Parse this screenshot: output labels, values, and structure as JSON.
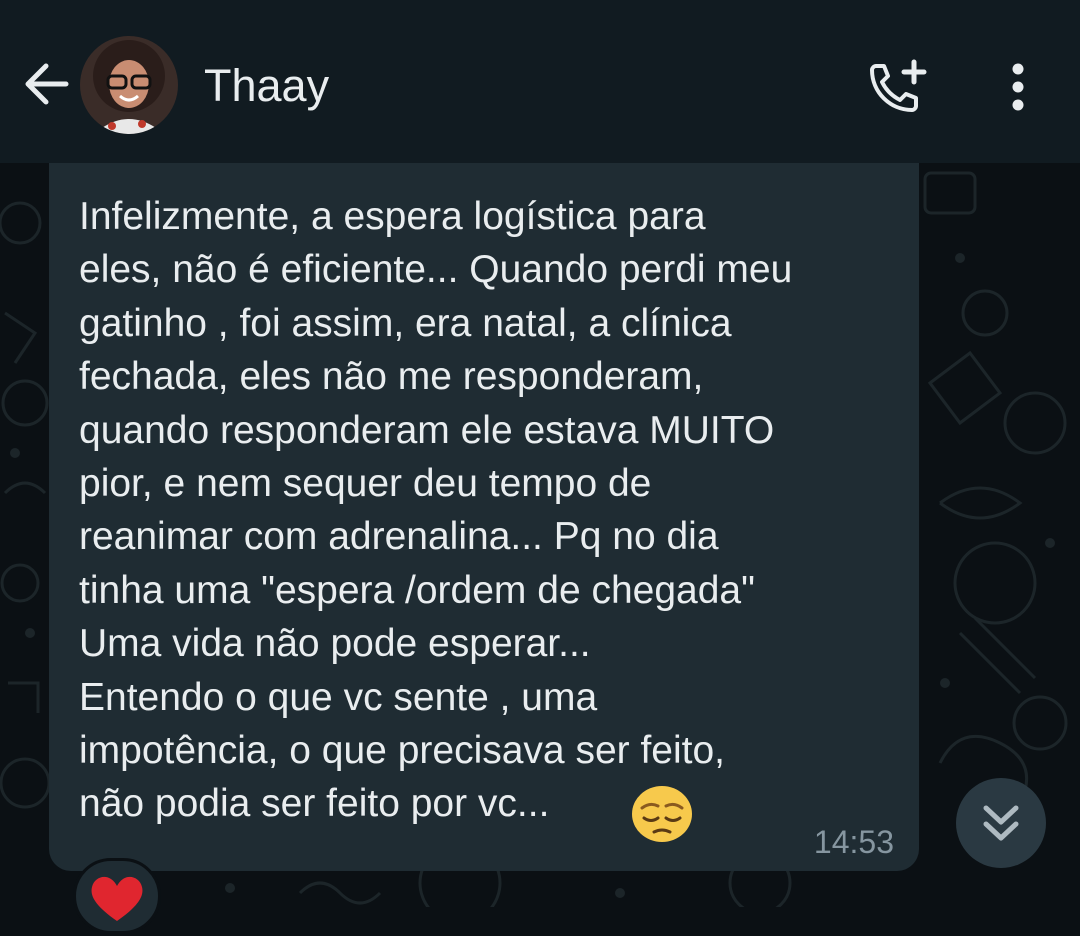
{
  "header": {
    "contact_name": "Thaay",
    "back_icon": "arrow-left-icon",
    "call_icon": "add-call-icon",
    "menu_icon": "more-vertical-icon"
  },
  "message": {
    "text": "Infelizmente, a espera logística para\neles, não é eficiente... Quando perdi meu\ngatinho , foi assim, era natal, a clínica\nfechada, eles não me responderam,\nquando responderam ele estava MUITO\npior, e nem sequer deu tempo de\nreanimar com adrenalina... Pq no dia\ntinha uma \"espera /ordem de chegada\"\nUma vida não pode esperar...\nEntendo o que vc sente , uma\nimpotência, o que precisava ser feito,\nnão podia ser feito por vc...",
    "emoji": "pensive-face-emoji",
    "time": "14:53",
    "reaction": "red-heart-emoji"
  },
  "colors": {
    "header_bg": "#111b21",
    "bubble_bg": "#1f2c33",
    "chat_bg": "#0b1014",
    "text": "#e9edef",
    "meta": "#8696a0"
  }
}
